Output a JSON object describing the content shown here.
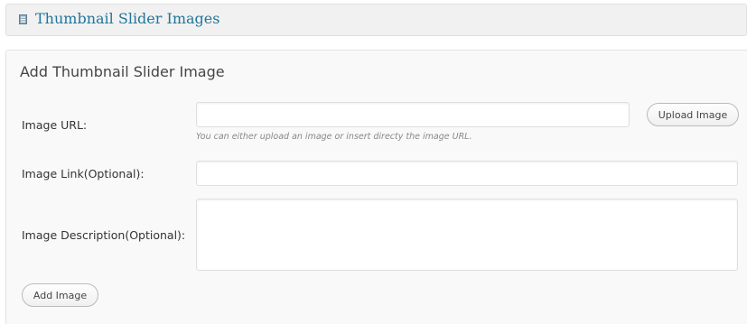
{
  "header": {
    "icon": "list-grid-icon",
    "title": "Thumbnail Slider Images"
  },
  "form": {
    "title": "Add Thumbnail Slider Image",
    "image_url": {
      "label": "Image URL:",
      "value": "",
      "hint": "You can either upload an image or insert directy the image URL."
    },
    "upload_button": "Upload Image",
    "image_link": {
      "label": "Image Link(Optional):",
      "value": ""
    },
    "image_description": {
      "label": "Image Description(Optional):",
      "value": ""
    },
    "add_button": "Add Image"
  },
  "colors": {
    "title_link": "#21759b",
    "panel_bg": "#f9f9f9",
    "header_bg": "#f1f1f1"
  }
}
